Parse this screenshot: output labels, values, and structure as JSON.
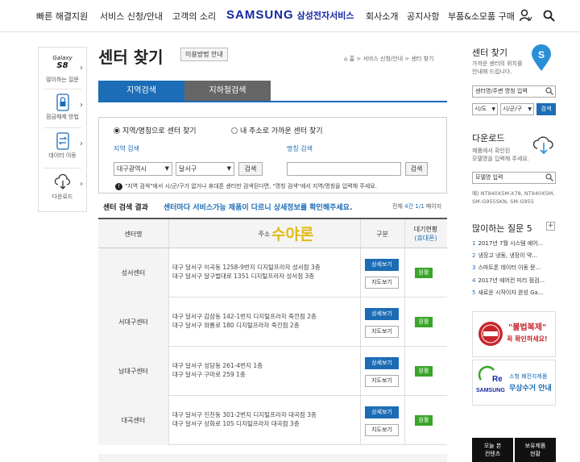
{
  "nav": {
    "left_items": [
      "빠른 해결지원",
      "서비스 신청/안내",
      "고객의 소리"
    ],
    "brand": "SAMSUNG",
    "brand_sub": "삼성전자서비스",
    "right_items": [
      "회사소개",
      "공지사항",
      "부품&소모품 구매"
    ]
  },
  "quickmenu": {
    "items": [
      {
        "title": "Galaxy",
        "model": "S8",
        "label": "많이하는 질문"
      },
      {
        "label": "잠금해제 방법"
      },
      {
        "label": "데이터 이동"
      },
      {
        "label": "다운로드"
      }
    ]
  },
  "header": {
    "title": "센터 찾기",
    "howto_button": "이용방법 안내",
    "breadcrumb": [
      "홈",
      "서비스 신청/안내",
      "센터 찾기"
    ]
  },
  "tabs": [
    "지역검색",
    "지하철검색"
  ],
  "search": {
    "radio_1": "지역/명칭으로 센터 찾기",
    "radio_2": "내 주소로 가까운 센터 찾기",
    "region_label": "지역 검색",
    "name_label": "명칭 검색",
    "city_value": "대구광역시",
    "district_value": "달서구",
    "search_button": "검색",
    "notice": "\"지역 검색\"에서 시/군/구가 없거나 휴대폰 센터만 검색된다면, \"명칭 검색\"에서 지역/명칭을 입력해 주세요."
  },
  "results": {
    "title": "센터 검색 결과",
    "message": "센터마다 서비스가능 제품이 다르니 상세정보를 확인해주세요.",
    "count_prefix": "전체",
    "count_total": "4건",
    "count_page": "1/1",
    "count_suffix": "페이지",
    "columns": {
      "name": "센터명",
      "address": "주소",
      "type": "구분",
      "wait_1": "대기현황",
      "wait_2": "(휴대폰)"
    },
    "detail_button": "상세보기",
    "map_button": "지도보기",
    "status_label": "원활",
    "rows": [
      {
        "name": "성서센터",
        "addr1": "대구 달서구 이곡동 1258-9번지 디지털프라자 성서점 3층",
        "addr2": "대구 달서구 달구벌대로 1351 디지털프라자 성서점 3층"
      },
      {
        "name": "서대구센터",
        "addr1": "대구 달서구 감삼동 142-1번지 디지털프라자 죽전점 2층",
        "addr2": "대구 달서구 와룡로 180 디지털프라자 죽전점 2층"
      },
      {
        "name": "남대구센터",
        "addr1": "대구 달서구 성당동 261-4번지 1층",
        "addr2": "대구 달서구 구마로 259 1층"
      },
      {
        "name": "대곡센터",
        "addr1": "대구 달서구 진천동 301-2번지 디지털프라자 대곡점 3층",
        "addr2": "대구 달서구 상화로 105 디지털프라자 대곡점 3층"
      }
    ]
  },
  "watermark": "수야론",
  "sidebar": {
    "find_title": "센터 찾기",
    "find_desc_1": "가까운 센터의 위치를",
    "find_desc_2": "안내해 드립니다.",
    "find_placeholder": "센터명/주변 명칭 입력",
    "sel_city": "시/도",
    "sel_district": "시/군/구",
    "sel_button": "검색",
    "download_title": "다운로드",
    "download_desc_1": "제품에서 확인된",
    "download_desc_2": "모델명을 입력해 주세요.",
    "model_placeholder": "모델명 입력",
    "model_example_1": "예) NT940X5M-X78, NT940X5M,",
    "model_example_2": "SM-G955SKN, SM-G955",
    "faq_title": "많이하는 질문 5",
    "faq": [
      {
        "n": "1",
        "text": "2017년 7월 시스템 에어..."
      },
      {
        "n": "2",
        "text": "냉장고 냉동, 냉장이 약..."
      },
      {
        "n": "3",
        "text": "스마트폰 데이터 이동 문..."
      },
      {
        "n": "4",
        "text": "2017년 에어컨 미리 점검..."
      },
      {
        "n": "5",
        "text": "새로운 시작이자 완성 Ga..."
      }
    ],
    "banner1_text": "\"불법복제\"",
    "banner1_sub": "꼭 확인하세요!",
    "banner2_brand": "SAMSUNG",
    "banner2_text_1": "소형 폐전자제품",
    "banner2_text_2": "무상수거 안내",
    "bottom_1": [
      "오늘 본",
      "컨텐츠"
    ],
    "bottom_2": [
      "보유제품",
      "현황"
    ]
  }
}
